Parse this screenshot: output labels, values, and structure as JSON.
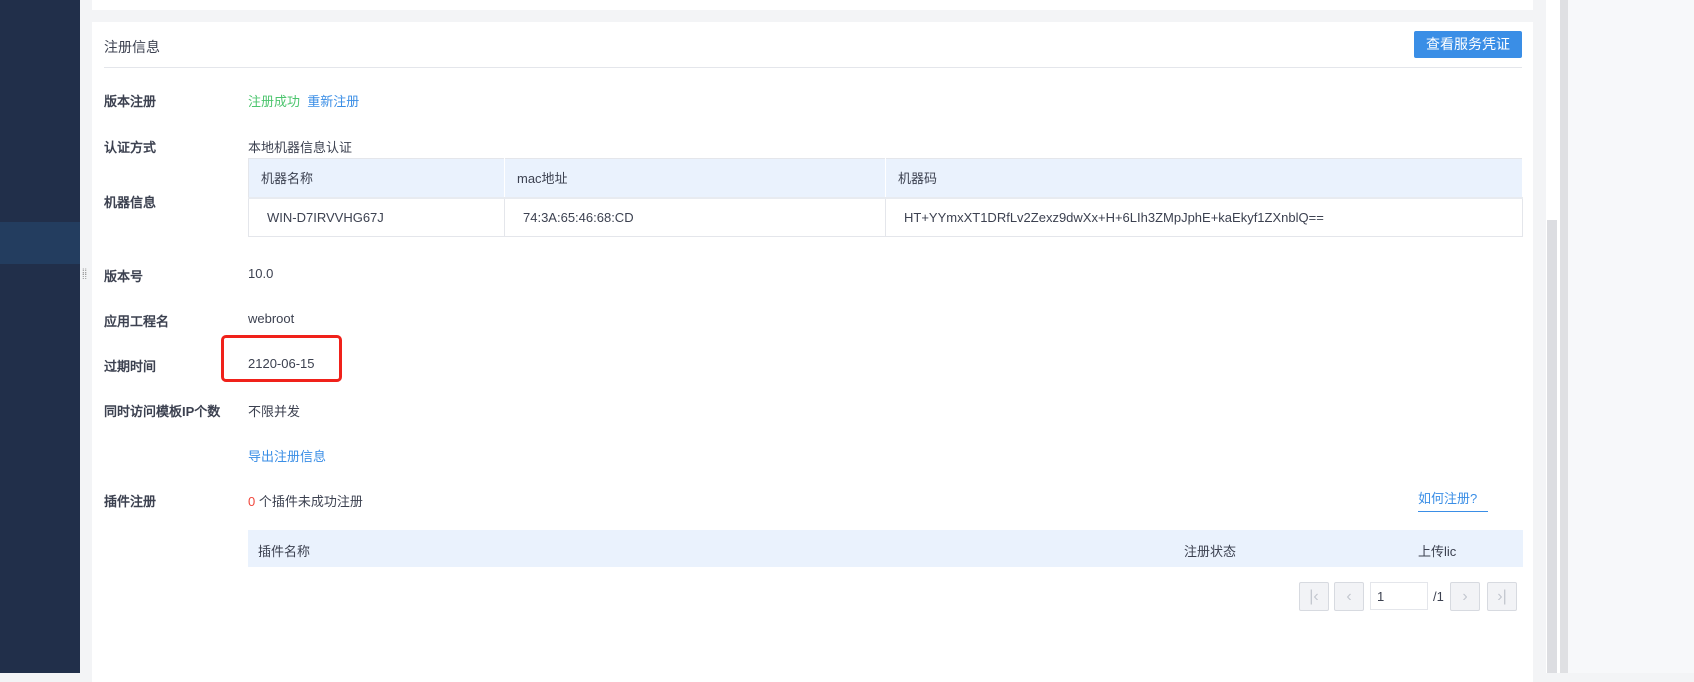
{
  "header": {
    "title": "注册信息",
    "cert_button": "查看服务凭证"
  },
  "rows": {
    "version_reg": {
      "label": "版本注册",
      "status": "注册成功",
      "reregister": "重新注册"
    },
    "auth": {
      "label": "认证方式",
      "value": "本地机器信息认证"
    },
    "machine": {
      "label": "机器信息",
      "columns": [
        "机器名称",
        "mac地址",
        "机器码"
      ],
      "row": [
        "WIN-D7IRVVHG67J",
        "74:3A:65:46:68:CD",
        "HT+YYmxXT1DRfLv2Zexz9dwXx+H+6LIh3ZMpJphE+kaEkyf1ZXnblQ=="
      ]
    },
    "version": {
      "label": "版本号",
      "value": "10.0"
    },
    "app": {
      "label": "应用工程名",
      "value": "webroot"
    },
    "expire": {
      "label": "过期时间",
      "value": "2120-06-15"
    },
    "ip": {
      "label": "同时访问模板IP个数",
      "value": "不限并发"
    },
    "export": "导出注册信息",
    "plugin": {
      "label": "插件注册",
      "count": "0",
      "count_text": "个插件未成功注册",
      "how": "如何注册?",
      "columns": [
        "插件名称",
        "注册状态",
        "上传lic"
      ]
    }
  },
  "pagination": {
    "page": "1",
    "total": "/1"
  },
  "colors": {
    "accent": "#3a8ee6",
    "success": "#4cc56e",
    "sidebar": "#212f4a",
    "highlight": "#f0211a"
  }
}
